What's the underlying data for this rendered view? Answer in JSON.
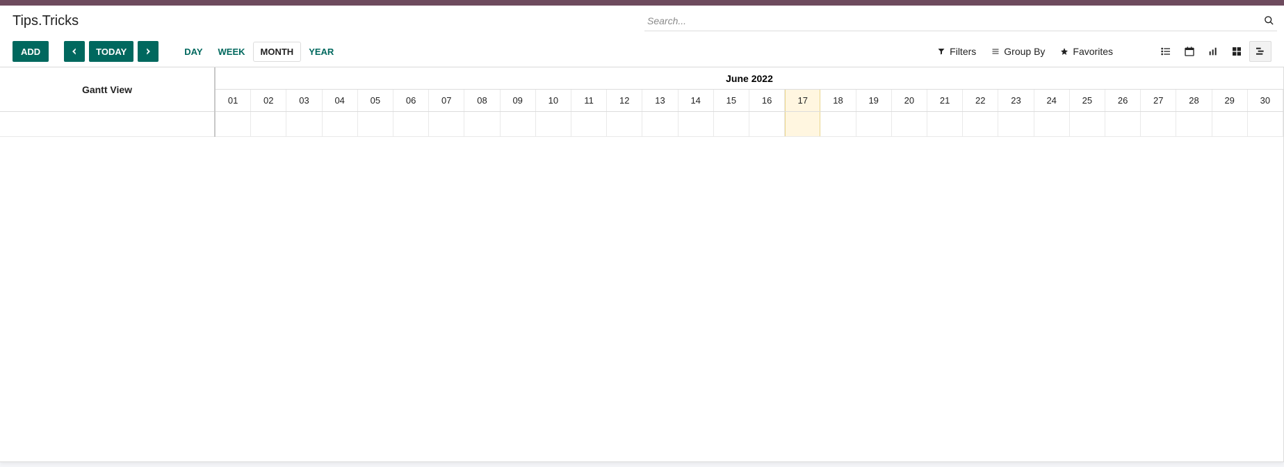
{
  "app": {
    "title": "Tips.Tricks"
  },
  "search": {
    "placeholder": "Search..."
  },
  "toolbar": {
    "add_label": "ADD",
    "today_label": "TODAY",
    "scales": [
      {
        "key": "day",
        "label": "DAY"
      },
      {
        "key": "week",
        "label": "WEEK"
      },
      {
        "key": "month",
        "label": "MONTH"
      },
      {
        "key": "year",
        "label": "YEAR"
      }
    ],
    "active_scale": "month",
    "filters_label": "Filters",
    "groupby_label": "Group By",
    "favorites_label": "Favorites",
    "views": [
      {
        "key": "list",
        "name": "list-icon"
      },
      {
        "key": "calendar",
        "name": "calendar-icon"
      },
      {
        "key": "graph",
        "name": "graph-icon"
      },
      {
        "key": "kanban",
        "name": "kanban-icon"
      },
      {
        "key": "gantt",
        "name": "gantt-icon"
      }
    ],
    "active_view": "gantt"
  },
  "gantt": {
    "title": "Gantt View",
    "period_label": "June 2022",
    "days": [
      "01",
      "02",
      "03",
      "04",
      "05",
      "06",
      "07",
      "08",
      "09",
      "10",
      "11",
      "12",
      "13",
      "14",
      "15",
      "16",
      "17",
      "18",
      "19",
      "20",
      "21",
      "22",
      "23",
      "24",
      "25",
      "26",
      "27",
      "28",
      "29",
      "30"
    ],
    "today": "17"
  }
}
